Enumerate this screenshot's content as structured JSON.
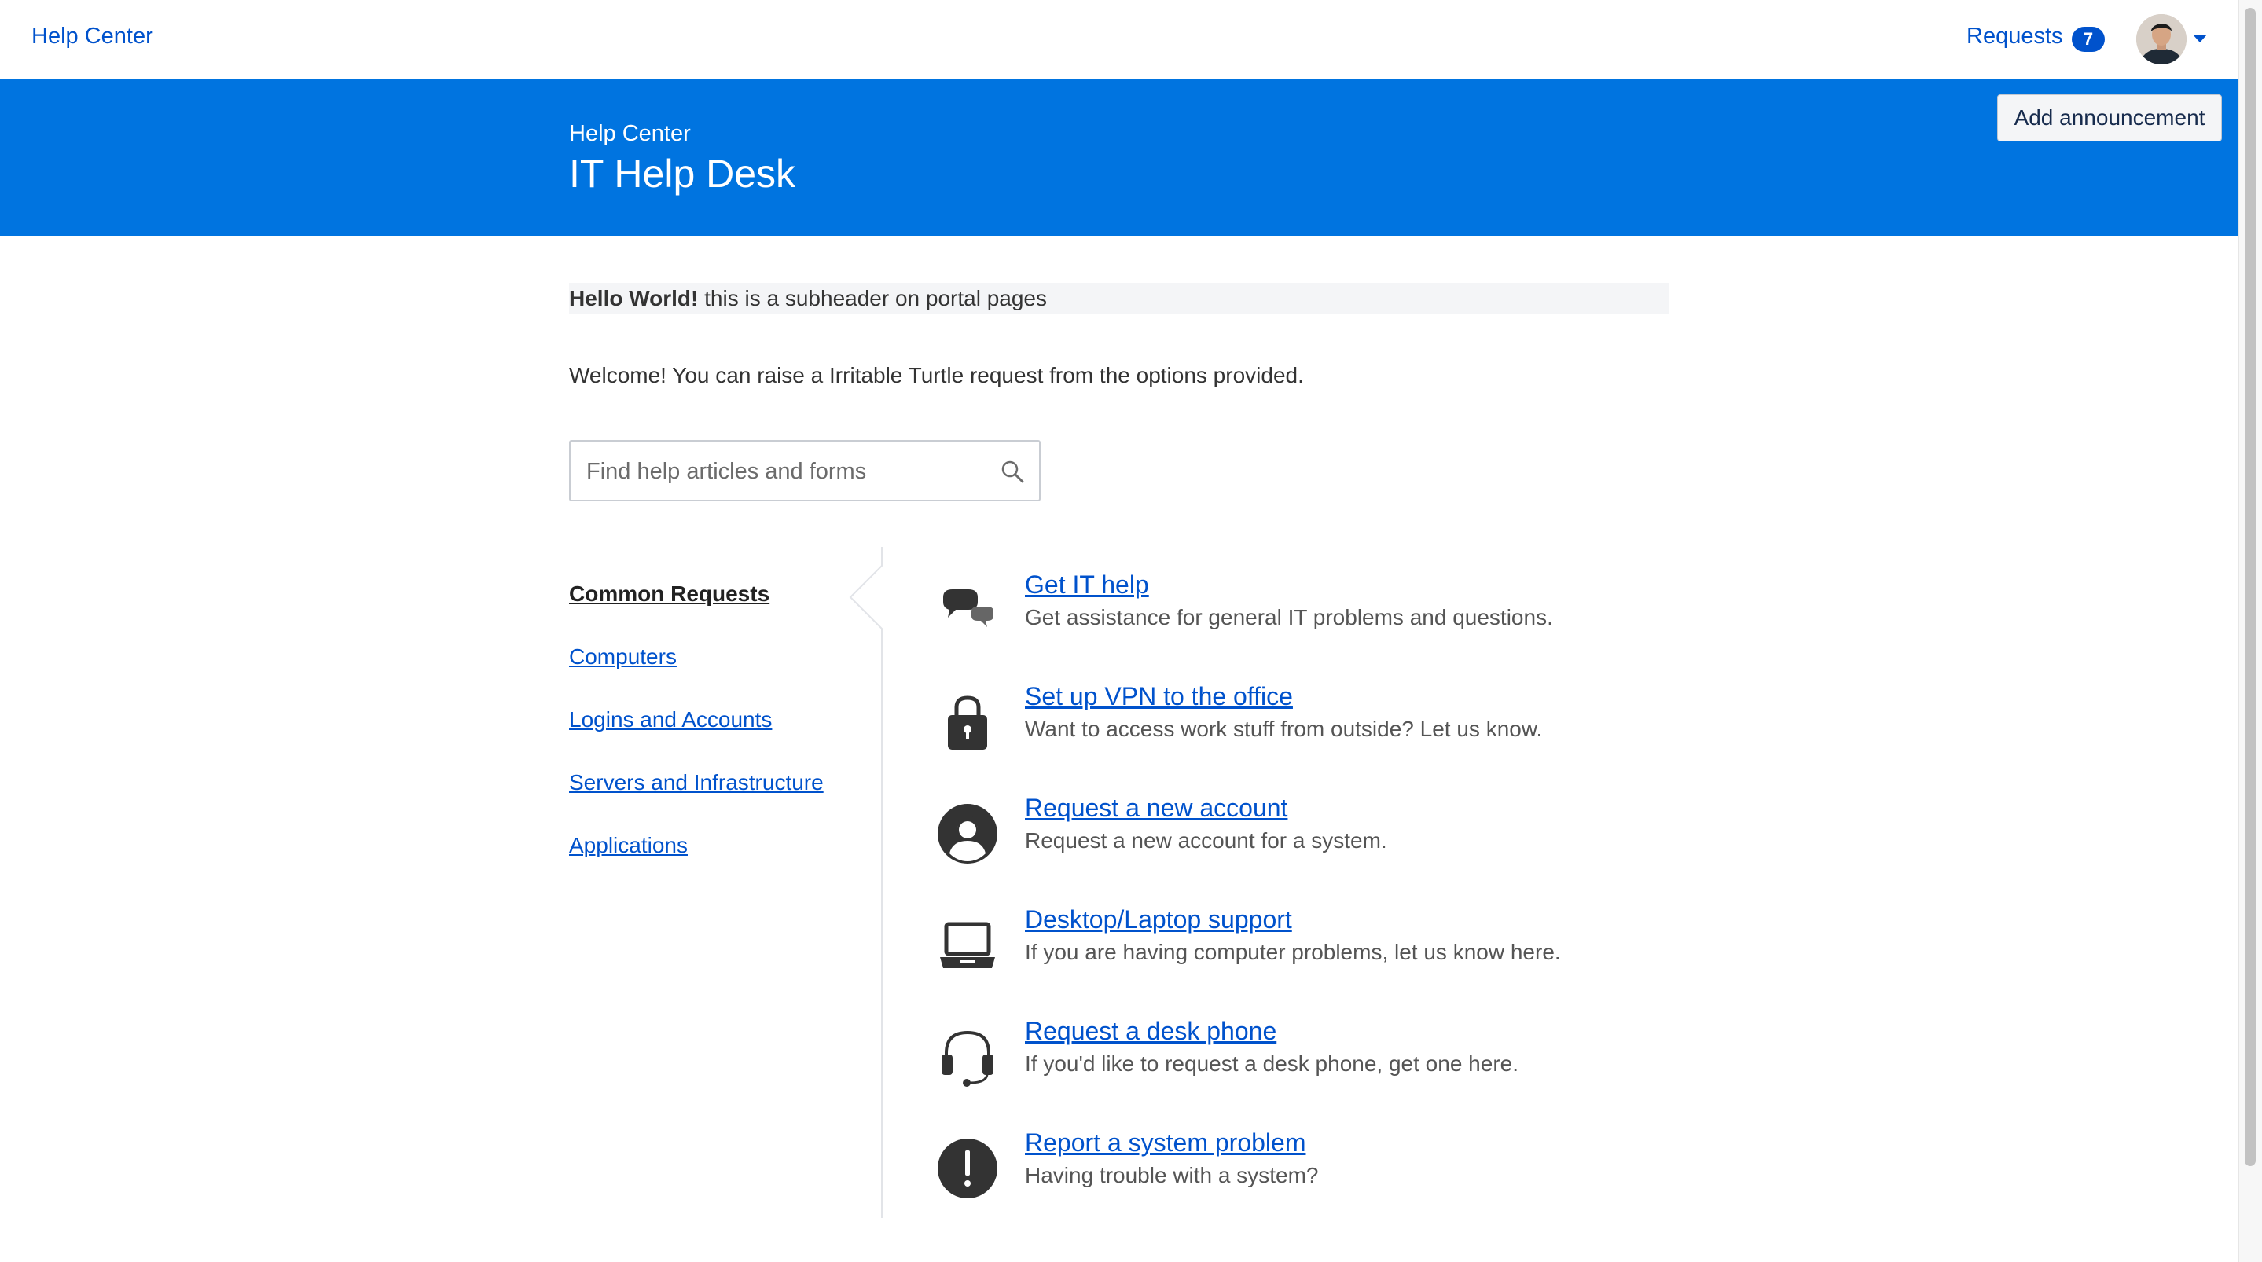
{
  "topnav": {
    "brand": "Help Center",
    "requests_label": "Requests",
    "requests_count": "7"
  },
  "banner": {
    "breadcrumb": "Help Center",
    "title": "IT Help Desk",
    "announce_button": "Add announcement"
  },
  "subheader": {
    "bold": "Hello World!",
    "text": " this is a subheader on portal pages"
  },
  "welcome": "Welcome! You can raise a Irritable Turtle request from the options provided.",
  "search": {
    "placeholder": "Find help articles and forms"
  },
  "categories": [
    {
      "label": "Common Requests",
      "active": true
    },
    {
      "label": "Computers",
      "active": false
    },
    {
      "label": "Logins and Accounts",
      "active": false
    },
    {
      "label": "Servers and Infrastructure",
      "active": false
    },
    {
      "label": "Applications",
      "active": false
    }
  ],
  "request_types": [
    {
      "icon": "chat-bubbles-icon",
      "name": "Get IT help",
      "desc": "Get assistance for general IT problems and questions."
    },
    {
      "icon": "padlock-icon",
      "name": "Set up VPN to the office",
      "desc": "Want to access work stuff from outside? Let us know."
    },
    {
      "icon": "user-account-icon",
      "name": "Request a new account",
      "desc": "Request a new account for a system."
    },
    {
      "icon": "laptop-icon",
      "name": "Desktop/Laptop support",
      "desc": "If you are having computer problems, let us know here."
    },
    {
      "icon": "headset-icon",
      "name": "Request a desk phone",
      "desc": "If you'd like to request a desk phone, get one here."
    },
    {
      "icon": "exclamation-icon",
      "name": "Report a system problem",
      "desc": "Having trouble with a system?"
    }
  ],
  "colors": {
    "brand_blue": "#0074e0",
    "link_blue": "#0052cc",
    "icon_dark": "#333333"
  }
}
